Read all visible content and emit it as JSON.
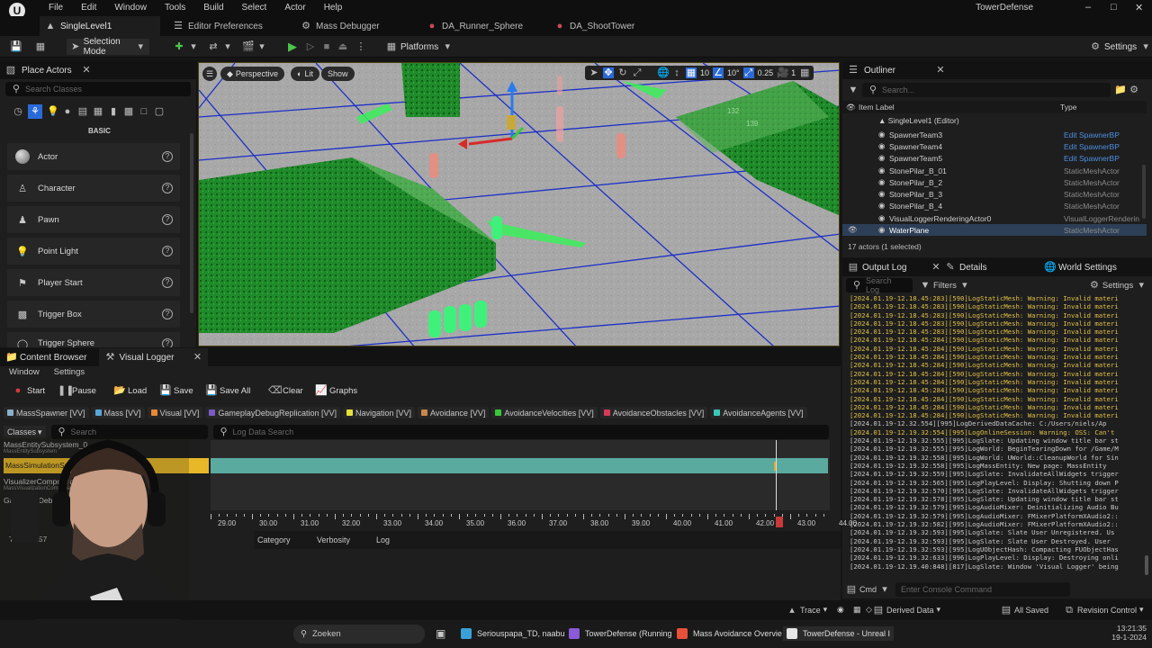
{
  "app": {
    "title": "TowerDefense",
    "menu": [
      "File",
      "Edit",
      "Window",
      "Tools",
      "Build",
      "Select",
      "Actor",
      "Help"
    ],
    "tabs": [
      "SingleLevel1",
      "Editor Preferences",
      "Mass Debugger",
      "DA_Runner_Sphere",
      "DA_ShootTower"
    ]
  },
  "toolbar": {
    "selection_mode": "Selection Mode",
    "platforms": "Platforms",
    "settings": "Settings"
  },
  "place_actors": {
    "title": "Place Actors",
    "search_placeholder": "Search Classes",
    "category": "BASIC",
    "items": [
      "Actor",
      "Character",
      "Pawn",
      "Point Light",
      "Player Start",
      "Trigger Box",
      "Trigger Sphere"
    ]
  },
  "viewport": {
    "perspective": "Perspective",
    "lit": "Lit",
    "show": "Show",
    "grid_snap": "10",
    "rot_snap": "10°",
    "scale_snap": "0.25",
    "camera_speed": "1",
    "actor_labels": [
      "132",
      "139"
    ]
  },
  "outliner": {
    "title": "Outliner",
    "search_placeholder": "Search...",
    "col_label": "Item Label",
    "col_type": "Type",
    "root": "SingleLevel1 (Editor)",
    "rows": [
      {
        "label": "SpawnerTeam3",
        "type": "Edit SpawnerBP"
      },
      {
        "label": "SpawnerTeam4",
        "type": "Edit SpawnerBP"
      },
      {
        "label": "SpawnerTeam5",
        "type": "Edit SpawnerBP"
      },
      {
        "label": "StonePilar_B_01",
        "type": "StaticMeshActor"
      },
      {
        "label": "StonePilar_B_2",
        "type": "StaticMeshActor"
      },
      {
        "label": "StonePilar_B_3",
        "type": "StaticMeshActor"
      },
      {
        "label": "StonePilar_B_4",
        "type": "StaticMeshActor"
      },
      {
        "label": "VisualLoggerRenderingActor0",
        "type": "VisualLoggerRenderin"
      },
      {
        "label": "WaterPlane",
        "type": "StaticMeshActor"
      }
    ],
    "status": "17 actors (1 selected)"
  },
  "output_log": {
    "tabs": [
      "Output Log",
      "Details",
      "World Settings"
    ],
    "search_placeholder": "Search Log",
    "filters": "Filters",
    "settings": "Settings",
    "lines": [
      "[2024.01.19-12.18.45:283][590]LogStaticMesh: Warning: Invalid materi",
      "[2024.01.19-12.18.45:283][590]LogStaticMesh: Warning: Invalid materi",
      "[2024.01.19-12.18.45:283][590]LogStaticMesh: Warning: Invalid materi",
      "[2024.01.19-12.18.45:283][590]LogStaticMesh: Warning: Invalid materi",
      "[2024.01.19-12.18.45:283][590]LogStaticMesh: Warning: Invalid materi",
      "[2024.01.19-12.18.45:284][590]LogStaticMesh: Warning: Invalid materi",
      "[2024.01.19-12.18.45:284][590]LogStaticMesh: Warning: Invalid materi",
      "[2024.01.19-12.18.45:284][590]LogStaticMesh: Warning: Invalid materi",
      "[2024.01.19-12.18.45:284][590]LogStaticMesh: Warning: Invalid materi",
      "[2024.01.19-12.18.45:284][590]LogStaticMesh: Warning: Invalid materi",
      "[2024.01.19-12.18.45:284][590]LogStaticMesh: Warning: Invalid materi",
      "[2024.01.19-12.18.45:284][590]LogStaticMesh: Warning: Invalid materi",
      "[2024.01.19-12.18.45:284][590]LogStaticMesh: Warning: Invalid materi",
      "[2024.01.19-12.18.45:284][590]LogStaticMesh: Warning: Invalid materi",
      "[2024.01.19-12.18.45:284][590]LogStaticMesh: Warning: Invalid materi",
      "[2024.01.19-12.32.554][995]LogDerivedDataCache: C:/Users/niels/Ap",
      "[2024.01.19-12.19.32:554][995]LogOnlineSession: Warning: OSS: Can't",
      "[2024.01.19-12.19.32:555][995]LogSlate: Updating window title bar st",
      "[2024.01.19-12.19.32:555][995]LogWorld: BeginTearingDown for /Game/M",
      "[2024.01.19-12.19.32:558][995]LogWorld: UWorld::CleanupWorld for Sin",
      "[2024.01.19-12.19.32:558][995]LogMassEntity: New page: MassEntity",
      "[2024.01.19-12.19.32:559][995]LogSlate: InvalidateAllWidgets trigger",
      "[2024.01.19-12.19.32:565][995]LogPlayLevel: Display: Shutting down P",
      "[2024.01.19-12.19.32:570][995]LogSlate: InvalidateAllWidgets trigger",
      "[2024.01.19-12.19.32:578][995]LogSlate: Updating window title bar st",
      "[2024.01.19-12.19.32:579][995]LogAudioMixer: Deinitializing Audio Bu",
      "[2024.01.19-12.19.32:579][995]LogAudioMixer: FMixerPlatformXAudio2::",
      "[2024.01.19-12.19.32:582][995]LogAudioMixer: FMixerPlatformXAudio2::",
      "[2024.01.19-12.19.32:593][995]LogSlate: Slate User Unregistered.  Us",
      "[2024.01.19-12.19.32:593][995]LogSlate: Slate User Destroyed.  User",
      "[2024.01.19-12.19.32:593][995]LogUObjectHash: Compacting FUObjectHas",
      "[2024.01.19-12.19.32:633][996]LogPlayLevel: Display: Destroying onli",
      "[2024.01.19-12.19.40:848][817]LogSlate: Window 'Visual Logger' being"
    ],
    "cmd": "Cmd",
    "console_placeholder": "Enter Console Command"
  },
  "visual_logger": {
    "tabs": [
      "Content Browser",
      "Visual Logger"
    ],
    "menu": [
      "Window",
      "Settings"
    ],
    "buttons": [
      "Start",
      "Pause",
      "Load",
      "Save",
      "Save All",
      "Clear",
      "Graphs"
    ],
    "chips": [
      {
        "label": "MassSpawner [VV]",
        "color": "#8ab0c8"
      },
      {
        "label": "Mass [VV]",
        "color": "#58a6d6"
      },
      {
        "label": "Visual [VV]",
        "color": "#e8883a"
      },
      {
        "label": "GameplayDebugReplication [VV]",
        "color": "#7a5cc4"
      },
      {
        "label": "Navigation [VV]",
        "color": "#e8e03a"
      },
      {
        "label": "Avoidance [VV]",
        "color": "#c8884a"
      },
      {
        "label": "AvoidanceVelocities [VV]",
        "color": "#3ac83a"
      },
      {
        "label": "AvoidanceObstacles [VV]",
        "color": "#d83a5a"
      },
      {
        "label": "AvoidanceAgents [VV]",
        "color": "#3ac8b8"
      }
    ],
    "classes": "Classes",
    "search_placeholder": "Search",
    "log_search_placeholder": "Log Data Search",
    "rows": [
      {
        "name": "MassEntitySubsystem_0",
        "sub": "MassEntitySubsystem"
      },
      {
        "name": "MassSimulationSubsystem",
        "sub": ""
      },
      {
        "name": "VisualizerComponent",
        "sub": "MassVisualizationComponent"
      },
      {
        "name": "GameplayDebugger",
        "sub": ""
      }
    ],
    "time_ticks": [
      "29.00",
      "30.00",
      "31.00",
      "32.00",
      "33.00",
      "34.00",
      "35.00",
      "36.00",
      "37.00",
      "38.00",
      "39.00",
      "40.00",
      "41.00",
      "42.00",
      "43.00",
      "44.00"
    ],
    "time_label": "Time 42.57",
    "cols": [
      "Category",
      "Verbosity",
      "Log"
    ]
  },
  "statusbar": {
    "trace": "Trace",
    "derived_data": "Derived Data",
    "all_saved": "All Saved",
    "revision_control": "Revision Control"
  },
  "taskbar": {
    "search": "Zoeken",
    "apps": [
      {
        "label": "Seriouspapa_TD, naabu",
        "color": "#3aa0d8"
      },
      {
        "label": "TowerDefense (Running",
        "color": "#8a5ad8"
      },
      {
        "label": "Mass Avoidance Overvie",
        "color": "#e8503a"
      },
      {
        "label": "TowerDefense - Unreal I",
        "color": "#e6e6e6"
      }
    ],
    "time": "13:21:35",
    "date": "19-1-2024"
  }
}
